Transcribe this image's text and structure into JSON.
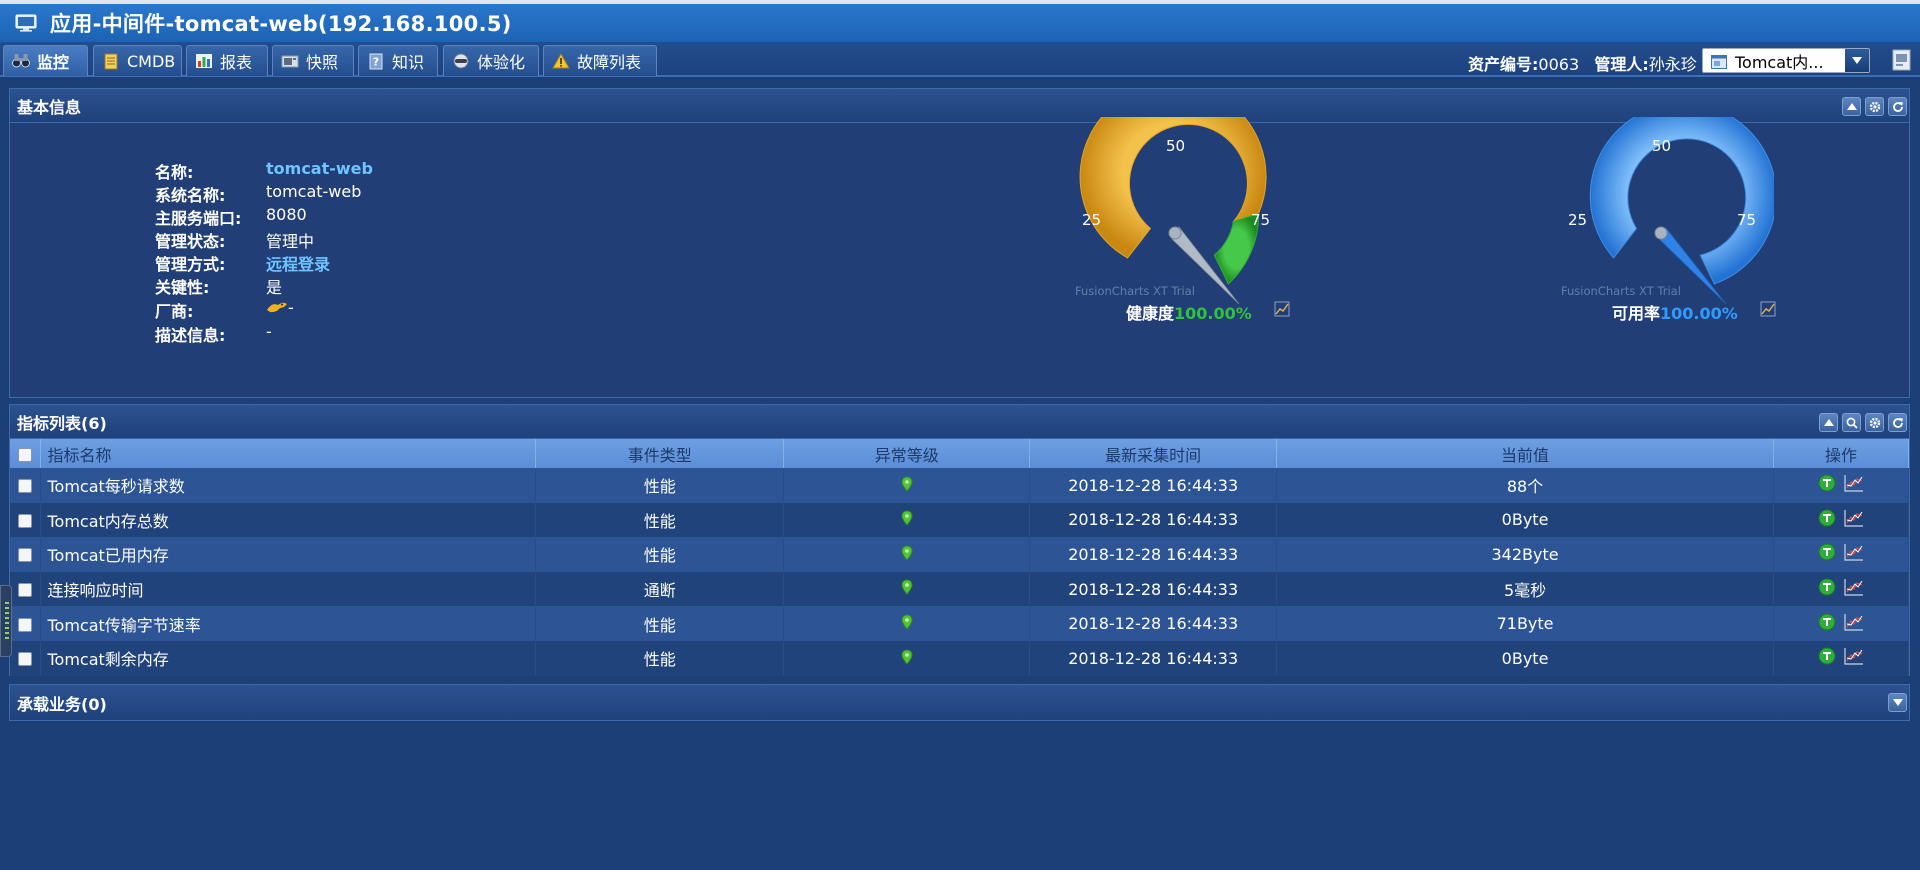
{
  "window": {
    "title": "应用-中间件-tomcat-web(192.168.100.5)"
  },
  "tabs": [
    {
      "label": "监控",
      "icon": "binoculars-icon",
      "active": true
    },
    {
      "label": "CMDB",
      "icon": "document-icon",
      "active": false
    },
    {
      "label": "报表",
      "icon": "bar-chart-icon",
      "active": false
    },
    {
      "label": "快照",
      "icon": "snapshot-icon",
      "active": false
    },
    {
      "label": "知识",
      "icon": "question-book-icon",
      "active": false
    },
    {
      "label": "体验化",
      "icon": "helmet-icon",
      "active": false
    },
    {
      "label": "故障列表",
      "icon": "warning-icon",
      "active": false
    }
  ],
  "asset": {
    "asset_no_label": "资产编号:",
    "asset_no": "0063",
    "manager_label": "管理人:",
    "manager": "孙永珍"
  },
  "view_select": {
    "value": "Tomcat内..."
  },
  "basic_panel": {
    "title": "基本信息",
    "fields": [
      {
        "label": "名称:",
        "value": "tomcat-web",
        "style": "link"
      },
      {
        "label": "系统名称:",
        "value": "tomcat-web",
        "style": "plain"
      },
      {
        "label": "主服务端口:",
        "value": "8080",
        "style": "plain"
      },
      {
        "label": "管理状态:",
        "value": "管理中",
        "style": "plain"
      },
      {
        "label": "管理方式:",
        "value": "远程登录",
        "style": "link"
      },
      {
        "label": "关键性:",
        "value": "是",
        "style": "plain"
      },
      {
        "label": "厂商:",
        "value": "-",
        "style": "vendor"
      },
      {
        "label": "描述信息:",
        "value": "-",
        "style": "plain"
      }
    ],
    "gauges": [
      {
        "tick_labels": [
          "25",
          "50",
          "75"
        ],
        "watermark": "FusionCharts XT Trial",
        "caption_label": "健康度",
        "caption_value": "100.00%",
        "value_percent": 100,
        "value_color": "#2fc23a",
        "colors": {
          "band_warn": "#e9a92a",
          "band_ok": "#2fae2f",
          "needle": "#9aa7b6"
        }
      },
      {
        "tick_labels": [
          "25",
          "50",
          "75"
        ],
        "watermark": "FusionCharts XT Trial",
        "caption_label": "可用率",
        "caption_value": "100.00%",
        "value_percent": 100,
        "value_color": "#2f9bff",
        "colors": {
          "band": "#4aa0ee",
          "needle": "#2a7fe0"
        }
      }
    ]
  },
  "metrics_panel": {
    "title": "指标列表(6)",
    "columns": [
      "指标名称",
      "事件类型",
      "异常等级",
      "最新采集时间",
      "当前值",
      "操作"
    ],
    "rows": [
      {
        "name": "Tomcat每秒请求数",
        "type": "性能",
        "level": "normal",
        "time": "2018-12-28 16:44:33",
        "value": "88个"
      },
      {
        "name": "Tomcat内存总数",
        "type": "性能",
        "level": "normal",
        "time": "2018-12-28 16:44:33",
        "value": "0Byte"
      },
      {
        "name": "Tomcat已用内存",
        "type": "性能",
        "level": "normal",
        "time": "2018-12-28 16:44:33",
        "value": "342Byte"
      },
      {
        "name": "连接响应时间",
        "type": "通断",
        "level": "normal",
        "time": "2018-12-28 16:44:33",
        "value": "5毫秒"
      },
      {
        "name": "Tomcat传输字节速率",
        "type": "性能",
        "level": "normal",
        "time": "2018-12-28 16:44:33",
        "value": "71Byte"
      },
      {
        "name": "Tomcat剩余内存",
        "type": "性能",
        "level": "normal",
        "time": "2018-12-28 16:44:33",
        "value": "0Byte"
      }
    ]
  },
  "business_panel": {
    "title": "承载业务(0)"
  },
  "colors": {
    "background": "#1d3f78",
    "title_bar": "#1c62b4",
    "table_header": "#5b8ed6",
    "link": "#6fc3ff",
    "level_normal": "#52c43a"
  }
}
